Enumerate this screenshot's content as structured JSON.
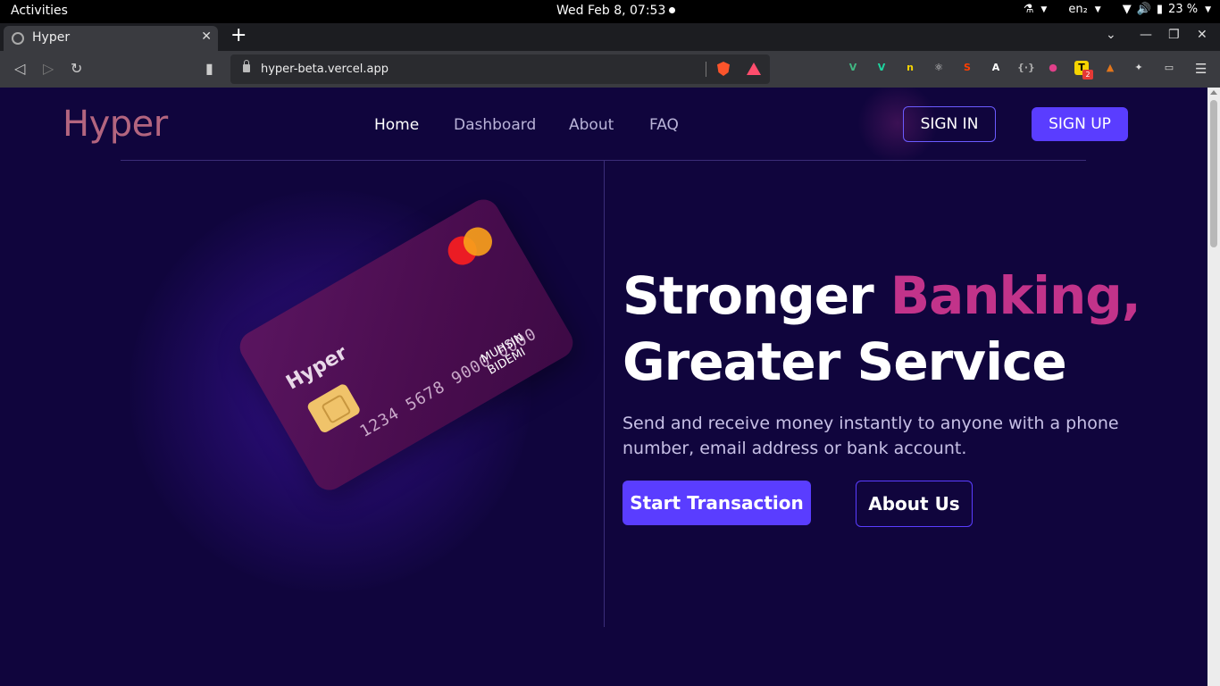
{
  "system": {
    "activities": "Activities",
    "clock": "Wed Feb  8, 07:53",
    "language": "en₂",
    "battery": "23 %"
  },
  "browser": {
    "tab_title": "Hyper",
    "url": "hyper-beta.vercel.app",
    "extensions": [
      {
        "name": "vue-devtools-icon",
        "glyph": "V",
        "color": "#41b883"
      },
      {
        "name": "vuetify-icon",
        "glyph": "V",
        "color": "#1ed6a0"
      },
      {
        "name": "extension-yellow-icon",
        "glyph": "n",
        "color": "#f5d400"
      },
      {
        "name": "react-devtools-icon",
        "glyph": "⚛",
        "color": "#dddddd"
      },
      {
        "name": "svelte-icon",
        "glyph": "S",
        "color": "#ff3e00"
      },
      {
        "name": "angular-icon",
        "glyph": "A",
        "color": "#ffffff"
      },
      {
        "name": "json-formatter-icon",
        "glyph": "{·}",
        "color": "#aaaaaa"
      },
      {
        "name": "color-picker-icon",
        "glyph": "●",
        "color": "#e0408a"
      },
      {
        "name": "todoist-icon",
        "glyph": "T",
        "color": "#f5d400"
      },
      {
        "name": "metamask-icon",
        "glyph": "▲",
        "color": "#e2761b"
      },
      {
        "name": "extensions-puzzle-icon",
        "glyph": "✦",
        "color": "#dddddd"
      },
      {
        "name": "wallet-icon",
        "glyph": "▭",
        "color": "#dddddd"
      }
    ],
    "todoist_badge": "2"
  },
  "site": {
    "logo": "Hyper",
    "nav": [
      "Home",
      "Dashboard",
      "About",
      "FAQ"
    ],
    "sign_in": "SIGN IN",
    "sign_up": "SIGN UP"
  },
  "card": {
    "brand": "Hyper",
    "number": "1234 5678 9000 0000",
    "holder": "MUHSIN BIDEMI"
  },
  "hero": {
    "title_part1": "Stronger ",
    "title_accent": "Banking,",
    "title_line2": "Greater Service",
    "subtitle": "Send and receive money instantly to anyone with a phone number, email address or bank account.",
    "cta_primary": "Start Transaction",
    "cta_secondary": "About Us"
  },
  "colors": {
    "page_bg": "#10053d",
    "accent_purple": "#5a3dff",
    "accent_pink": "#c2338a",
    "logo": "#b3657f"
  }
}
